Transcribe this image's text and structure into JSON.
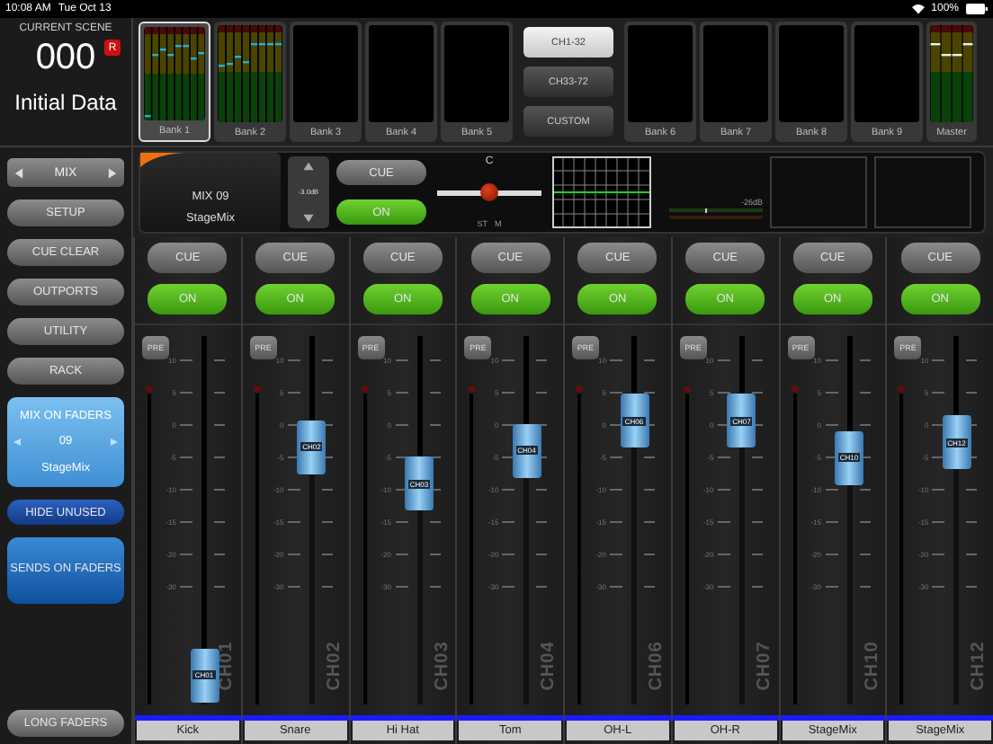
{
  "status_bar": {
    "time": "10:08 AM",
    "date": "Tue Oct 13",
    "battery": "100%"
  },
  "scene": {
    "caption": "CURRENT SCENE",
    "number": "000",
    "badge": "R",
    "name": "Initial Data"
  },
  "banks_left": [
    {
      "label": "Bank 1",
      "selected": true,
      "meters": true
    },
    {
      "label": "Bank 2",
      "selected": false,
      "meters": true
    },
    {
      "label": "Bank 3",
      "selected": false,
      "meters": false
    },
    {
      "label": "Bank 4",
      "selected": false,
      "meters": false
    },
    {
      "label": "Bank 5",
      "selected": false,
      "meters": false
    }
  ],
  "layer_buttons": [
    {
      "label": "CH1-32",
      "selected": true
    },
    {
      "label": "CH33-72",
      "selected": false
    },
    {
      "label": "CUSTOM",
      "selected": false
    }
  ],
  "banks_right": [
    {
      "label": "Bank 6",
      "selected": false,
      "meters": false
    },
    {
      "label": "Bank 7",
      "selected": false,
      "meters": false
    },
    {
      "label": "Bank 8",
      "selected": false,
      "meters": false
    },
    {
      "label": "Bank 9",
      "selected": false,
      "meters": false
    },
    {
      "label": "Master",
      "selected": false,
      "meters": true,
      "kind": "master"
    }
  ],
  "sidebar": {
    "nav": "MIX",
    "buttons": [
      "SETUP",
      "CUE CLEAR",
      "OUTPORTS",
      "UTILITY",
      "RACK"
    ],
    "mix_on_faders": {
      "title": "MIX ON FADERS",
      "number": "09",
      "name": "StageMix"
    },
    "hide_unused": "HIDE UNUSED",
    "sends_on_faders": "SENDS ON FADERS",
    "long_faders": "LONG FADERS"
  },
  "selected_channel": {
    "title": "MIX 09",
    "name": "StageMix",
    "gain": "-3.0dB",
    "cue": {
      "label": "CUE",
      "on": false
    },
    "on": {
      "label": "ON",
      "on": true
    },
    "pan": {
      "label": "C",
      "level": 0.5,
      "modes": [
        "ST",
        "M"
      ]
    },
    "meter_reading": "-26dB"
  },
  "channels": [
    {
      "cap": "CH01",
      "label": "CH01",
      "name": "Kick",
      "level": 0.08,
      "cue": {
        "label": "CUE",
        "on": false
      },
      "on": {
        "label": "ON",
        "on": true
      },
      "pre": "PRE",
      "scale": [
        "10",
        "5",
        "0",
        "-5",
        "-10",
        "-15",
        "-20",
        "-30"
      ]
    },
    {
      "cap": "CH02",
      "label": "CH02",
      "name": "Snare",
      "level": 0.7,
      "cue": {
        "label": "CUE",
        "on": false
      },
      "on": {
        "label": "ON",
        "on": true
      },
      "pre": "PRE",
      "scale": [
        "10",
        "5",
        "0",
        "-5",
        "-10",
        "-15",
        "-20",
        "-30"
      ]
    },
    {
      "cap": "CH03",
      "label": "CH03",
      "name": "Hi Hat",
      "level": 0.6,
      "cue": {
        "label": "CUE",
        "on": false
      },
      "on": {
        "label": "ON",
        "on": true
      },
      "pre": "PRE",
      "scale": [
        "10",
        "5",
        "0",
        "-5",
        "-10",
        "-15",
        "-20",
        "-30"
      ]
    },
    {
      "cap": "CH04",
      "label": "CH04",
      "name": "Tom",
      "level": 0.69,
      "cue": {
        "label": "CUE",
        "on": false
      },
      "on": {
        "label": "ON",
        "on": true
      },
      "pre": "PRE",
      "scale": [
        "10",
        "5",
        "0",
        "-5",
        "-10",
        "-15",
        "-20",
        "-30"
      ]
    },
    {
      "cap": "CH06",
      "label": "CH06",
      "name": "OH-L",
      "level": 0.77,
      "cue": {
        "label": "CUE",
        "on": false
      },
      "on": {
        "label": "ON",
        "on": true
      },
      "pre": "PRE",
      "scale": [
        "10",
        "5",
        "0",
        "-5",
        "-10",
        "-15",
        "-20",
        "-30"
      ]
    },
    {
      "cap": "CH07",
      "label": "CH07",
      "name": "OH-R",
      "level": 0.77,
      "cue": {
        "label": "CUE",
        "on": false
      },
      "on": {
        "label": "ON",
        "on": true
      },
      "pre": "PRE",
      "scale": [
        "10",
        "5",
        "0",
        "-5",
        "-10",
        "-15",
        "-20",
        "-30"
      ]
    },
    {
      "cap": "CH10",
      "label": "CH10",
      "name": "StageMix",
      "level": 0.67,
      "cue": {
        "label": "CUE",
        "on": false
      },
      "on": {
        "label": "ON",
        "on": true
      },
      "pre": "PRE",
      "scale": [
        "10",
        "5",
        "0",
        "-5",
        "-10",
        "-15",
        "-20",
        "-30"
      ]
    },
    {
      "cap": "CH12",
      "label": "CH12",
      "name": "StageMix",
      "level": 0.71,
      "cue": {
        "label": "CUE",
        "on": false
      },
      "on": {
        "label": "ON",
        "on": true
      },
      "pre": "PRE",
      "scale": [
        "10",
        "5",
        "0",
        "-5",
        "-10",
        "-15",
        "-20",
        "-30"
      ]
    }
  ]
}
